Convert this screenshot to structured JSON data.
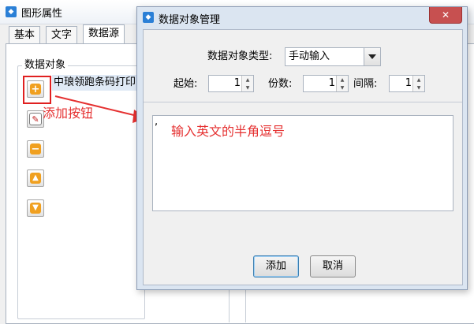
{
  "bg_window": {
    "title": "图形属性",
    "tabs": [
      "基本",
      "文字",
      "数据源"
    ],
    "group_title": "数据对象",
    "list_item": "中琅领跑条码打印"
  },
  "annotations": {
    "add_button_note": "添加按钮",
    "input_note": "输入英文的半角逗号"
  },
  "dialog": {
    "title": "数据对象管理",
    "close": "✕",
    "type_label": "数据对象类型:",
    "type_value": "手动输入",
    "start_label": "起始:",
    "start_value": "1",
    "copies_label": "份数:",
    "copies_value": "1",
    "interval_label": "间隔:",
    "interval_value": "1",
    "text_content": ",",
    "add_button": "添加",
    "cancel_button": "取消"
  },
  "colors": {
    "annotation_red": "#e53030",
    "icon_orange": "#f0a020",
    "icon_blue": "#2a7fd6"
  }
}
